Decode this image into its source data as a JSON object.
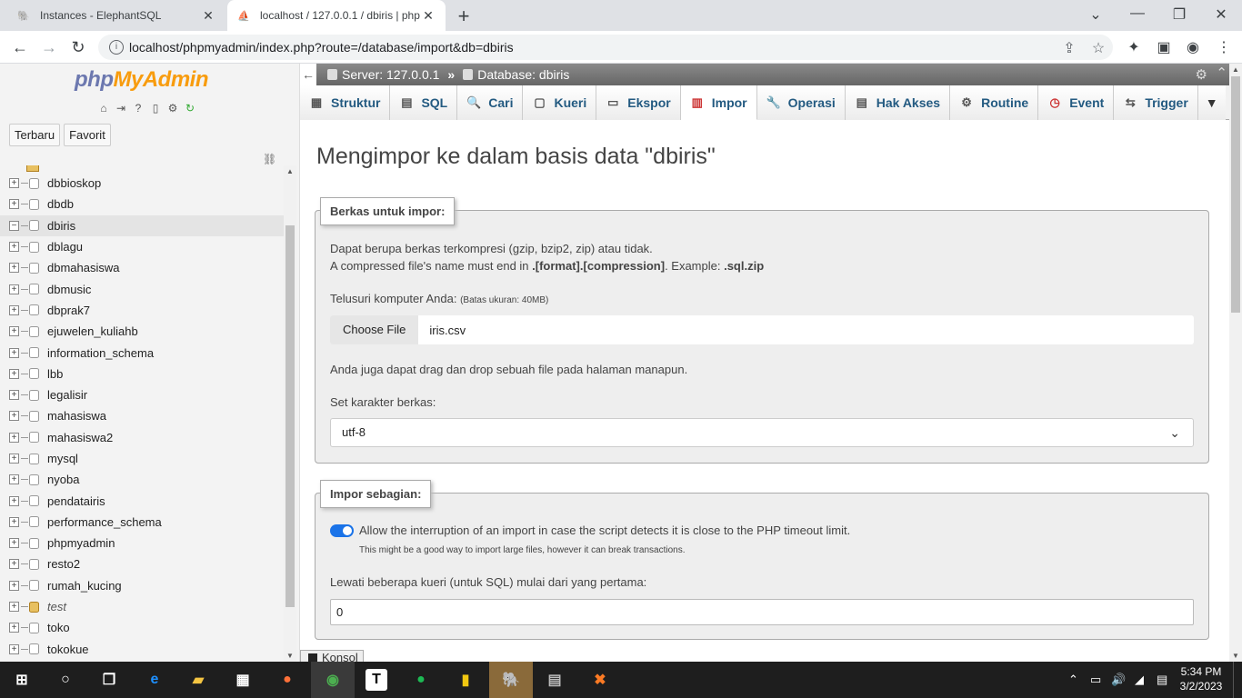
{
  "browser": {
    "tabs": [
      {
        "title": "Instances - ElephantSQL",
        "active": false
      },
      {
        "title": "localhost / 127.0.0.1 / dbiris | php",
        "active": true
      }
    ],
    "url": "localhost/phpmyadmin/index.php?route=/database/import&db=dbiris"
  },
  "sidebar": {
    "logo_a": "php",
    "logo_b": "MyAdmin",
    "tabs": [
      "Terbaru",
      "Favorit"
    ],
    "databases": [
      {
        "name": "dbbioskop",
        "expanded": false,
        "selected": false
      },
      {
        "name": "dbdb",
        "expanded": false,
        "selected": false
      },
      {
        "name": "dbiris",
        "expanded": true,
        "selected": true
      },
      {
        "name": "dblagu",
        "expanded": false,
        "selected": false
      },
      {
        "name": "dbmahasiswa",
        "expanded": false,
        "selected": false
      },
      {
        "name": "dbmusic",
        "expanded": false,
        "selected": false
      },
      {
        "name": "dbprak7",
        "expanded": false,
        "selected": false
      },
      {
        "name": "ejuwelen_kuliahb",
        "expanded": false,
        "selected": false
      },
      {
        "name": "information_schema",
        "expanded": false,
        "selected": false
      },
      {
        "name": "lbb",
        "expanded": false,
        "selected": false
      },
      {
        "name": "legalisir",
        "expanded": false,
        "selected": false
      },
      {
        "name": "mahasiswa",
        "expanded": false,
        "selected": false
      },
      {
        "name": "mahasiswa2",
        "expanded": false,
        "selected": false
      },
      {
        "name": "mysql",
        "expanded": false,
        "selected": false
      },
      {
        "name": "nyoba",
        "expanded": false,
        "selected": false
      },
      {
        "name": "pendatairis",
        "expanded": false,
        "selected": false
      },
      {
        "name": "performance_schema",
        "expanded": false,
        "selected": false
      },
      {
        "name": "phpmyadmin",
        "expanded": false,
        "selected": false
      },
      {
        "name": "resto2",
        "expanded": false,
        "selected": false
      },
      {
        "name": "rumah_kucing",
        "expanded": false,
        "selected": false
      },
      {
        "name": "test",
        "expanded": false,
        "selected": false,
        "italic": true
      },
      {
        "name": "toko",
        "expanded": false,
        "selected": false
      },
      {
        "name": "tokokue",
        "expanded": false,
        "selected": false
      }
    ]
  },
  "breadcrumb": {
    "server": "Server: 127.0.0.1",
    "separator": "»",
    "database": "Database: dbiris"
  },
  "menu_tabs": [
    "Struktur",
    "SQL",
    "Cari",
    "Kueri",
    "Ekspor",
    "Impor",
    "Operasi",
    "Hak Akses",
    "Routine",
    "Event",
    "Trigger"
  ],
  "active_tab": "Impor",
  "page": {
    "title": "Mengimpor ke dalam basis data \"dbiris\"",
    "file_section": {
      "legend": "Berkas untuk impor:",
      "line1": "Dapat berupa berkas terkompresi (gzip, bzip2, zip) atau tidak.",
      "line2_a": "A compressed file's name must end in ",
      "line2_b": ".[format].[compression]",
      "line2_c": ". Example: ",
      "line2_d": ".sql.zip",
      "browse_label": "Telusuri komputer Anda: ",
      "max_size": "(Batas ukuran: 40MB)",
      "choose_button": "Choose File",
      "file_name": "iris.csv",
      "drag_hint": "Anda juga dapat drag dan drop sebuah file pada halaman manapun.",
      "charset_label": "Set karakter berkas:",
      "charset_value": "utf-8"
    },
    "partial_section": {
      "legend": "Impor sebagian:",
      "allow_interrupt_label": "Allow the interruption of an import in case the script detects it is close to the PHP timeout limit.",
      "allow_interrupt_on": true,
      "interrupt_hint": "This might be a good way to import large files, however it can break transactions.",
      "skip_label": "Lewati beberapa kueri (untuk SQL) mulai dari yang pertama:",
      "skip_value": "0"
    }
  },
  "console_label": "Konsol",
  "taskbar": {
    "time": "5:34 PM",
    "date": "3/2/2023"
  }
}
